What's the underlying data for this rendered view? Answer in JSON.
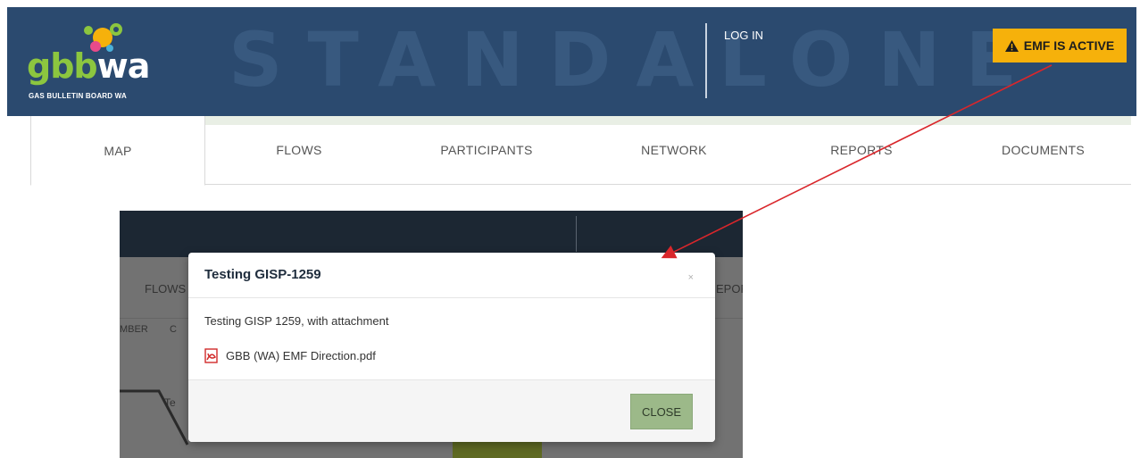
{
  "header": {
    "logo_main": "gbb",
    "logo_wa": "wa",
    "logo_subtitle": "GAS BULLETIN BOARD WA",
    "watermark": "STANDALONE",
    "login_label": "LOG IN",
    "emf_badge": "EMF IS ACTIVE"
  },
  "nav": {
    "items": [
      {
        "label": "MAP"
      },
      {
        "label": "FLOWS"
      },
      {
        "label": "PARTICIPANTS"
      },
      {
        "label": "NETWORK"
      },
      {
        "label": "REPORTS"
      },
      {
        "label": "DOCUMENTS"
      }
    ]
  },
  "background": {
    "flows_partial": "FLOWS",
    "reports_partial": "EPOR",
    "number_partial": "MBER",
    "extra_partial": "C",
    "te_partial": "Te"
  },
  "modal": {
    "title": "Testing GISP-1259",
    "close_x": "×",
    "body": "Testing GISP 1259, with attachment",
    "attachment": "GBB (WA) EMF Direction.pdf",
    "close_button": "CLOSE"
  },
  "colors": {
    "header_bg": "#2b4a6f",
    "badge_bg": "#f6b10b",
    "close_button_bg": "#9cb989",
    "arrow": "#d9262b"
  }
}
